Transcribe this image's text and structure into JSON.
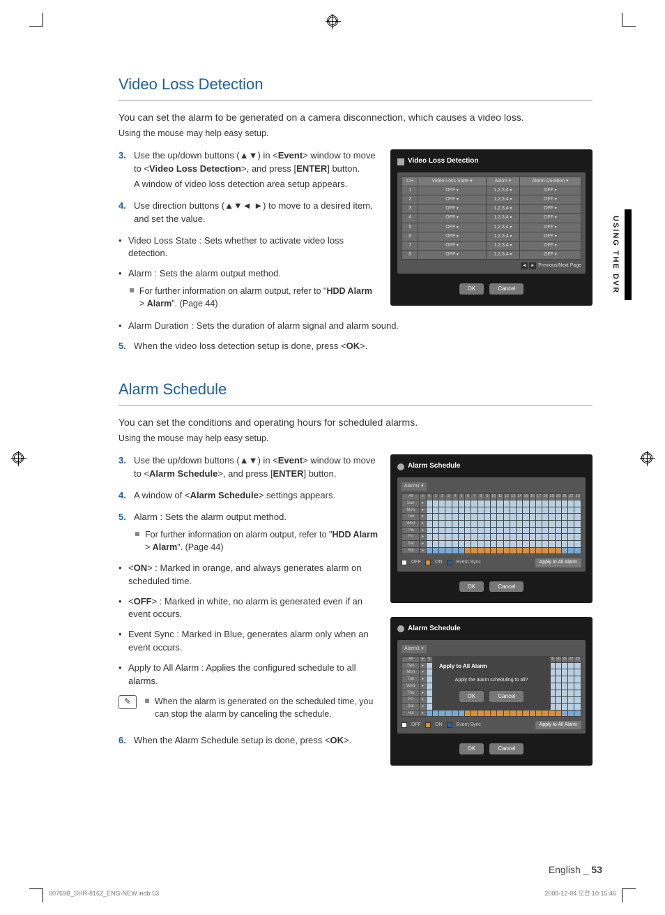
{
  "section1": {
    "title": "Video Loss Detection",
    "lead": "You can set the alarm to be generated on a camera disconnection, which causes a video loss.",
    "sublead": "Using the mouse may help easy setup.",
    "steps": [
      {
        "num": "3.",
        "text_a": "Use the up/down buttons (▲▼) in <",
        "b1": "Event",
        "text_b": "> window to move to <",
        "b2": "Video Loss Detection",
        "text_c": ">, and press [",
        "b3": "ENTER",
        "text_d": "] button.",
        "subtext": "A window of video loss detection area setup appears."
      },
      {
        "num": "4.",
        "text_a": "Use direction buttons (▲▼◄ ►) to move to a desired item, and set the value."
      }
    ],
    "bullets": [
      {
        "text": "Video Loss State : Sets whether to activate video loss detection."
      },
      {
        "text": "Alarm : Sets the alarm output method.",
        "sub": [
          {
            "pre": "For further information on alarm output, refer to \"",
            "b": "HDD Alarm",
            "mid": " > ",
            "b2": "Alarm",
            "post": "\". (Page 44)"
          }
        ]
      },
      {
        "text": "Alarm Duration : Sets the duration of alarm signal and alarm sound."
      }
    ],
    "step5": {
      "num": "5.",
      "text_a": "When the video loss detection setup is done, press <",
      "b": "OK",
      "text_b": ">."
    }
  },
  "section2": {
    "title": "Alarm Schedule",
    "lead": "You can set the conditions and operating hours for scheduled alarms.",
    "sublead": "Using the mouse may help easy setup.",
    "steps": [
      {
        "num": "3.",
        "text_a": "Use the up/down buttons (▲▼) in <",
        "b1": "Event",
        "text_b": "> window to move to <",
        "b2": "Alarm Schedule",
        "text_c": ">, and press [",
        "b3": "ENTER",
        "text_d": "] button."
      },
      {
        "num": "4.",
        "text_a": "A window of <",
        "b1": "Alarm Schedule",
        "text_b": "> settings appears."
      },
      {
        "num": "5.",
        "text_a": "Alarm : Sets the alarm output method.",
        "sub": [
          {
            "pre": "For further information on alarm output, refer to \"",
            "b": "HDD Alarm",
            "mid": " > ",
            "b2": "Alarm",
            "post": "\". (Page 44)"
          }
        ]
      }
    ],
    "bullets": [
      {
        "pre": "<",
        "b": "ON",
        "post": "> : Marked in orange, and always generates alarm on scheduled time."
      },
      {
        "pre": "<",
        "b": "OFF",
        "post": "> : Marked in white, no alarm is generated even if an event occurs."
      },
      {
        "text": "Event Sync : Marked in Blue, generates alarm only when an event occurs."
      },
      {
        "text": "Apply to All Alarm : Applies the configured schedule to all alarms."
      }
    ],
    "note": "When the alarm is generated on the scheduled time, you can stop the alarm by canceling the schedule.",
    "step6": {
      "num": "6.",
      "text_a": "When the Alarm Schedule setup is done, press <",
      "b": "OK",
      "text_b": ">."
    }
  },
  "sidetab": "USING THE DVR",
  "footer": {
    "lang": "English",
    "sep": "_",
    "page": "53"
  },
  "printline": {
    "left": "00769B_SHR-8162_ENG-NEW.indb   53",
    "right": "2008-12-04   오전 10:15:46"
  },
  "fig_vld": {
    "title": "Video Loss Detection",
    "headers": [
      "CH",
      "Video Loss State ▾",
      "Alarm ▾",
      "Alarm Duration ▾"
    ],
    "rows": [
      [
        "1",
        "OFF",
        "1,2,3,4",
        "OFF"
      ],
      [
        "2",
        "OFF",
        "1,2,3,4",
        "OFF"
      ],
      [
        "3",
        "OFF",
        "1,2,3,4",
        "OFF"
      ],
      [
        "4",
        "OFF",
        "1,2,3,4",
        "OFF"
      ],
      [
        "5",
        "OFF",
        "1,2,3,4",
        "OFF"
      ],
      [
        "6",
        "OFF",
        "1,2,3,4",
        "OFF"
      ],
      [
        "7",
        "OFF",
        "1,2,3,4",
        "OFF"
      ],
      [
        "8",
        "OFF",
        "1,2,3,4",
        "OFF"
      ]
    ],
    "pager": "Previous/Next Page",
    "ok": "OK",
    "cancel": "Cancel"
  },
  "fig_sched": {
    "title": "Alarm Schedule",
    "select": "Alarm1",
    "cornercell": "All",
    "hours": [
      "0",
      "1",
      "2",
      "3",
      "4",
      "5",
      "6",
      "7",
      "8",
      "9",
      "10",
      "11",
      "12",
      "13",
      "14",
      "15",
      "16",
      "17",
      "18",
      "19",
      "20",
      "21",
      "22",
      "23"
    ],
    "days": [
      "Sun",
      "Mon",
      "Tue",
      "Wed",
      "Thu",
      "Fri",
      "Sat",
      "Hol"
    ],
    "legend": {
      "off": "OFF",
      "on": "ON",
      "ev": "Event Sync",
      "apply": "Apply to All Alarm"
    },
    "ok": "OK",
    "cancel": "Cancel"
  },
  "fig_modal": {
    "title": "Apply to All Alarm",
    "text": "Apply the alarm scheduling to all?",
    "ok": "OK",
    "cancel": "Cancel"
  }
}
